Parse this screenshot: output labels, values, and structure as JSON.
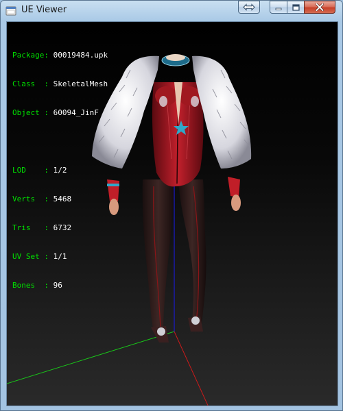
{
  "window": {
    "title": "UE Viewer",
    "icon": "ue-viewer-app-icon",
    "buttons": {
      "swap": "swap-arrows-icon",
      "minimize": "minimize-icon",
      "maximize": "maximize-icon",
      "close": "close-icon"
    }
  },
  "info": {
    "package": {
      "label": "Package",
      "sep": ": ",
      "value": "00019484.upk"
    },
    "class": {
      "label": "Class  ",
      "sep": ": ",
      "value": "SkeletalMesh"
    },
    "object": {
      "label": "Object ",
      "sep": ": ",
      "value": "60094_JinF"
    },
    "lod": {
      "label": "LOD    ",
      "sep": ": ",
      "value": "1/2"
    },
    "verts": {
      "label": "Verts  ",
      "sep": ": ",
      "value": "5468"
    },
    "tris": {
      "label": "Tris   ",
      "sep": ": ",
      "value": "6732"
    },
    "uvset": {
      "label": "UV Set ",
      "sep": ": ",
      "value": "1/1"
    },
    "bones": {
      "label": "Bones  ",
      "sep": ": ",
      "value": "96"
    }
  },
  "colors": {
    "label_green": "#00e000",
    "value_white": "#ffffff",
    "axis_x": "#cc1a1a",
    "axis_y": "#1a1acc",
    "axis_z": "#19c419"
  }
}
